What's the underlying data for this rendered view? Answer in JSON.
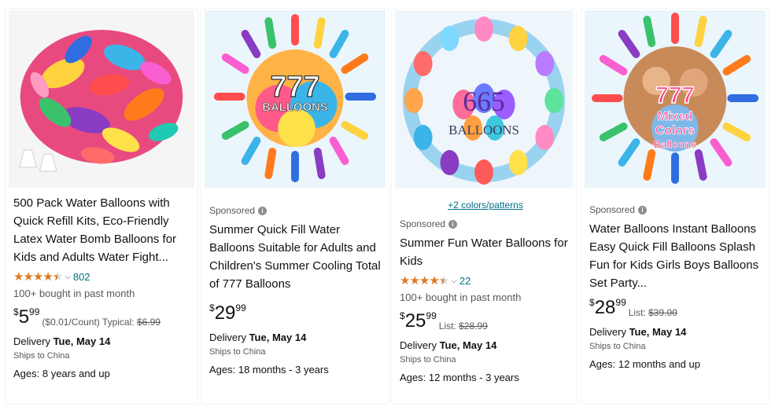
{
  "products": [
    {
      "sponsored": "",
      "colors_link": "",
      "title": "500 Pack Water Balloons with Quick Refill Kits, Eco-Friendly Latex Water Bomb Balloons for Kids and Adults Water Fight...",
      "rating": 4.5,
      "rating_count": "802",
      "bought": "100+ bought in past month",
      "price_symbol": "$",
      "price_whole": "5",
      "price_fraction": "99",
      "unit_price": "($0.01/Count)",
      "typical_label": "Typical:",
      "typical_price": "$6.99",
      "list_label": "",
      "list_price": "",
      "delivery_label": "Delivery",
      "delivery_date": "Tue, May 14",
      "ships": "Ships to China",
      "ages": "Ages: 8 years and up",
      "image_text": ""
    },
    {
      "sponsored": "Sponsored",
      "colors_link": "",
      "title": "Summer Quick Fill Water Balloons Suitable for Adults and Children's Summer Cooling Total of 777 Balloons",
      "rating": null,
      "rating_count": "",
      "bought": "",
      "price_symbol": "$",
      "price_whole": "29",
      "price_fraction": "99",
      "unit_price": "",
      "typical_label": "",
      "typical_price": "",
      "list_label": "",
      "list_price": "",
      "delivery_label": "Delivery",
      "delivery_date": "Tue, May 14",
      "ships": "Ships to China",
      "ages": "Ages: 18 months - 3 years",
      "image_text": "777 BALLOONS"
    },
    {
      "sponsored": "Sponsored",
      "colors_link": "+2 colors/patterns",
      "title": "Summer Fun Water Balloons for Kids",
      "rating": 4.5,
      "rating_count": "22",
      "bought": "100+ bought in past month",
      "price_symbol": "$",
      "price_whole": "25",
      "price_fraction": "99",
      "unit_price": "",
      "typical_label": "",
      "typical_price": "",
      "list_label": "List:",
      "list_price": "$28.99",
      "delivery_label": "Delivery",
      "delivery_date": "Tue, May 14",
      "ships": "Ships to China",
      "ages": "Ages: 12 months - 3 years",
      "image_text": "665 BALLOONS"
    },
    {
      "sponsored": "Sponsored",
      "colors_link": "",
      "title": "Water Balloons Instant Balloons Easy Quick Fill Balloons Splash Fun for Kids Girls Boys Balloons Set Party...",
      "rating": null,
      "rating_count": "",
      "bought": "",
      "price_symbol": "$",
      "price_whole": "28",
      "price_fraction": "99",
      "unit_price": "",
      "typical_label": "",
      "typical_price": "",
      "list_label": "List:",
      "list_price": "$39.00",
      "delivery_label": "Delivery",
      "delivery_date": "Tue, May 14",
      "ships": "Ships to China",
      "ages": "Ages: 12 months and up",
      "image_text": "777 Mixed Colors Balloons"
    }
  ],
  "colors": {
    "link": "#007185",
    "star": "#de7921",
    "muted": "#565959",
    "text": "#0f1111"
  },
  "icons": {
    "info": "info-icon",
    "chevron": "chevron-down-icon",
    "star": "star-icon"
  }
}
